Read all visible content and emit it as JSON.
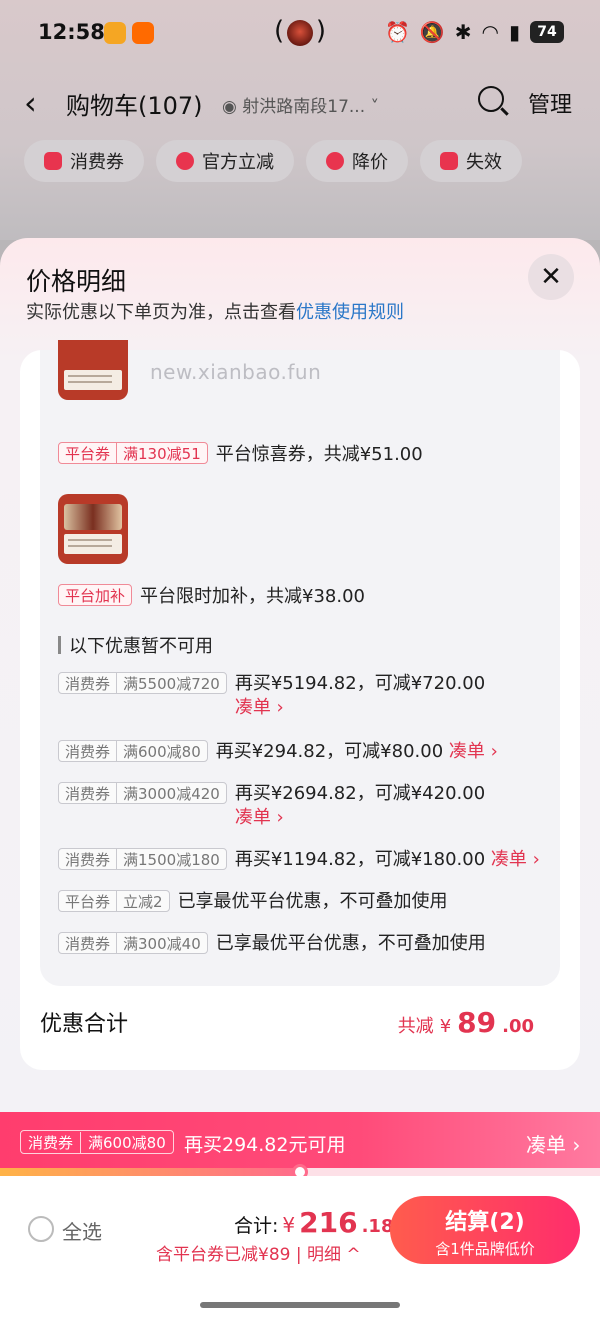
{
  "status_bar": {
    "time": "12:58",
    "battery": "74"
  },
  "nav": {
    "title": "购物车(107)",
    "address": "射洪路南段17...",
    "manage": "管理"
  },
  "chips": [
    "消费券",
    "官方立减",
    "降价",
    "失效"
  ],
  "sheet": {
    "title": "价格明细",
    "subtitle_prefix": "实际优惠以下单页为准，点击查看",
    "subtitle_link": "优惠使用规则",
    "watermark": "new.xianbao.fun",
    "discounts": [
      {
        "tag_a": "平台券",
        "tag_b": "满130减51",
        "text": "平台惊喜券，共减¥51.00"
      },
      {
        "tag_a": "平台加补",
        "text": "平台限时加补，共减¥38.00"
      }
    ],
    "unavailable_title": "以下优惠暂不可用",
    "unavailable": [
      {
        "tag_a": "消费券",
        "tag_b": "满5500减720",
        "text": "再买¥5194.82，可减¥720.00",
        "action": "凑单 ›"
      },
      {
        "tag_a": "消费券",
        "tag_b": "满600减80",
        "text": "再买¥294.82，可减¥80.00",
        "action": "凑单 ›"
      },
      {
        "tag_a": "消费券",
        "tag_b": "满3000减420",
        "text": "再买¥2694.82，可减¥420.00",
        "action": "凑单 ›"
      },
      {
        "tag_a": "消费券",
        "tag_b": "满1500减180",
        "text": "再买¥1194.82，可减¥180.00",
        "action": "凑单 ›"
      },
      {
        "tag_a": "平台券",
        "tag_b": "立减2",
        "text": "已享最优平台优惠，不可叠加使用"
      },
      {
        "tag_a": "消费券",
        "tag_b": "满300减40",
        "text": "已享最优平台优惠，不可叠加使用"
      }
    ],
    "summary_label": "优惠合计",
    "summary_prefix": "共减",
    "summary_yen": "¥",
    "summary_int": "89",
    "summary_dec": ".00"
  },
  "promo": {
    "tag_a": "消费券",
    "tag_b": "满600减80",
    "text": "再买294.82元可用",
    "action": "凑单 ›",
    "progress_fraction": 0.5
  },
  "checkout": {
    "select_all": "全选",
    "total_label": "合计:",
    "total_yen": "¥",
    "total_int": "216",
    "total_frac": ".18",
    "saved_text": "含平台券已减¥89 | 明细 ^",
    "button_main": "结算(2)",
    "button_sub": "含1件品牌低价"
  },
  "colors": {
    "accent": "#e23450",
    "link": "#2a77c8",
    "promo": "#ff3d6e"
  }
}
